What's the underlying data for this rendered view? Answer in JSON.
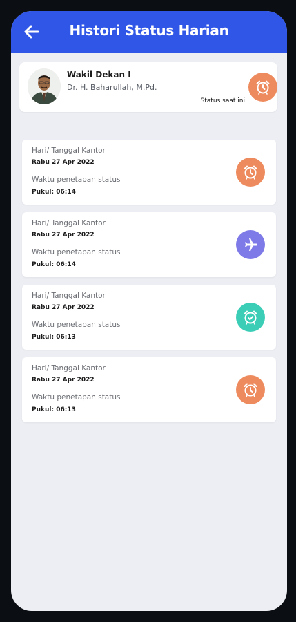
{
  "header": {
    "title": "Histori Status Harian"
  },
  "profile": {
    "role": "Wakil Dekan I",
    "name": "Dr. H. Baharullah, M.Pd.",
    "status_label": "Status saat ini",
    "status_icon": "alarm-clock-icon",
    "status_color": "#ee8b5e"
  },
  "history": [
    {
      "date_label": "Hari/ Tanggal Kantor",
      "date": "Rabu 27 Apr 2022",
      "time_label": "Waktu penetapan status",
      "time_prefix": "Pukul:",
      "time": "06:14",
      "icon": "alarm-clock-icon",
      "color": "#ee8b5e"
    },
    {
      "date_label": "Hari/ Tanggal Kantor",
      "date": "Rabu 27 Apr 2022",
      "time_label": "Waktu penetapan status",
      "time_prefix": "Pukul:",
      "time": "06:14",
      "icon": "airplane-icon",
      "color": "#7e7ae8"
    },
    {
      "date_label": "Hari/ Tanggal Kantor",
      "date": "Rabu 27 Apr 2022",
      "time_label": "Waktu penetapan status",
      "time_prefix": "Pukul:",
      "time": "06:13",
      "icon": "alarm-check-icon",
      "color": "#3ccdb6"
    },
    {
      "date_label": "Hari/ Tanggal Kantor",
      "date": "Rabu 27 Apr 2022",
      "time_label": "Waktu penetapan status",
      "time_prefix": "Pukul:",
      "time": "06:13",
      "icon": "alarm-clock-icon",
      "color": "#ee8b5e"
    }
  ]
}
